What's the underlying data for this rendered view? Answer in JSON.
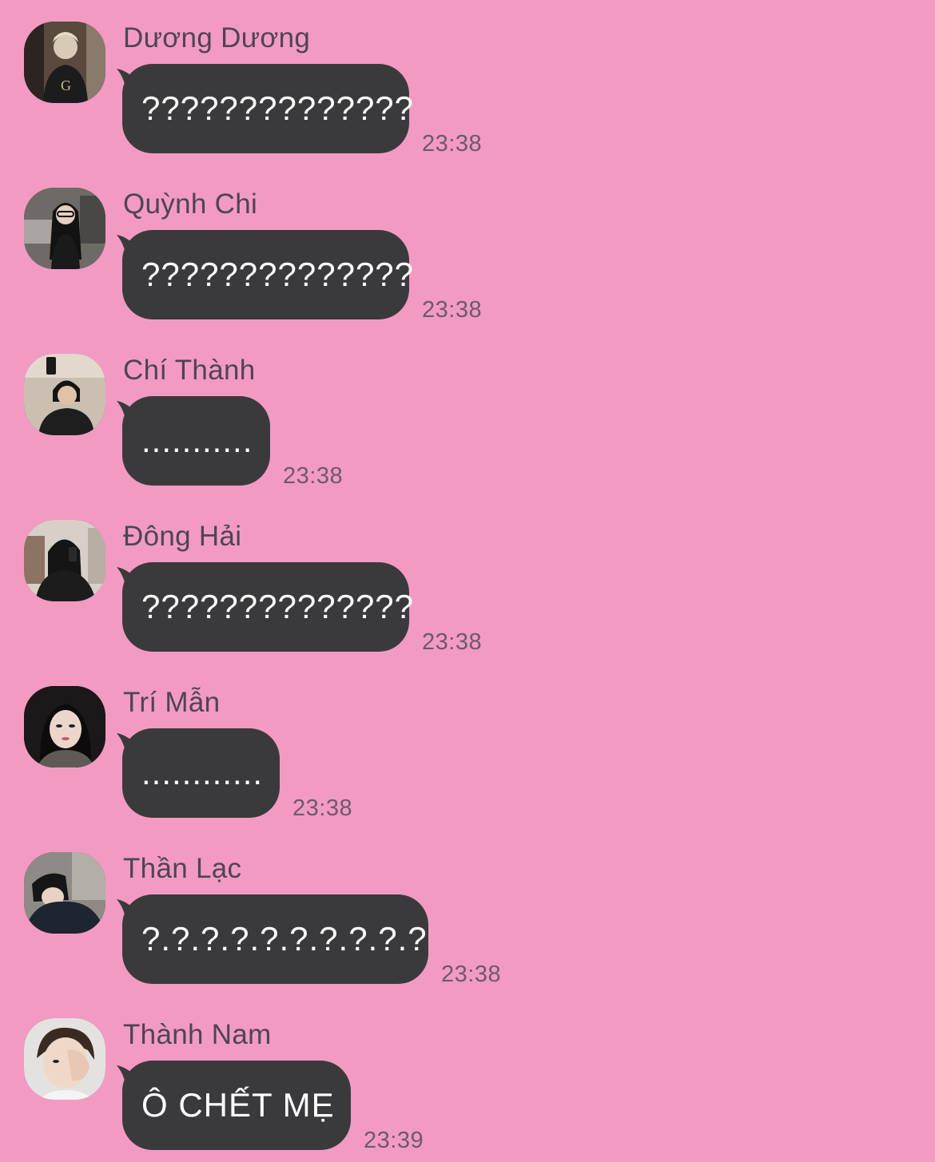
{
  "colors": {
    "background": "#f39ac3",
    "bubble": "#3a3a3c",
    "bubble_text": "#ffffff",
    "name_text": "#4d4650",
    "time_text": "#6b5b68"
  },
  "messages": [
    {
      "sender": "Dương Dương",
      "text": "??????????????",
      "time": "23:38",
      "avatar": "avatar-photo"
    },
    {
      "sender": "Quỳnh Chi",
      "text": "??????????????",
      "time": "23:38",
      "avatar": "avatar-photo"
    },
    {
      "sender": "Chí Thành",
      "text": "...........",
      "time": "23:38",
      "avatar": "avatar-photo"
    },
    {
      "sender": "Đông Hải",
      "text": "??????????????",
      "time": "23:38",
      "avatar": "avatar-photo"
    },
    {
      "sender": "Trí Mẫn",
      "text": "............",
      "time": "23:38",
      "avatar": "avatar-photo"
    },
    {
      "sender": "Thần Lạc",
      "text": "?.?.?.?.?.?.?.?.?.?",
      "time": "23:38",
      "avatar": "avatar-photo"
    },
    {
      "sender": "Thành Nam",
      "text": "Ô CHẾT MẸ",
      "time": "23:39",
      "avatar": "avatar-photo"
    }
  ]
}
